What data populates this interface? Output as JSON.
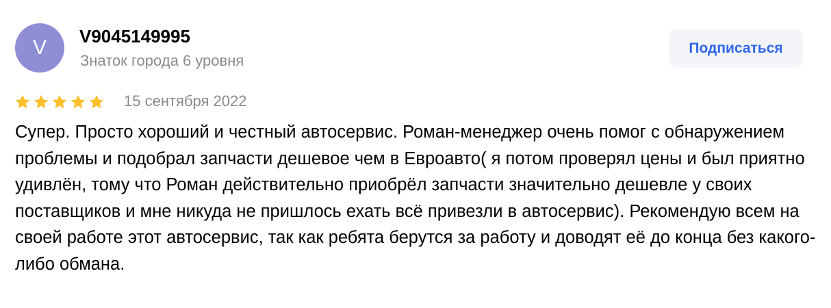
{
  "review": {
    "author": {
      "avatar_letter": "V",
      "avatar_color": "#8e8dd6",
      "name": "V9045149995",
      "level": "Знаток города 6 уровня"
    },
    "subscribe_label": "Подписаться",
    "rating": {
      "value": 5,
      "max": 5,
      "star_color": "#fdc02c",
      "icon": "star-icon"
    },
    "date": "15 сентября 2022",
    "text": "Супер. Просто хороший и честный автосервис. Роман-менеджер очень помог с обнаружением проблемы и подобрал запчасти дешевое чем в Евроавто( я потом проверял цены и был приятно удивлён, тому что Роман действительно приобрёл запчасти значительно дешевле у своих поставщиков и мне никуда не пришлось ехать всё привезли в автосервис). Рекомендую всем на своей работе этот автосервис, так как ребята берутся за работу и доводят её до конца без какого-либо обмана."
  },
  "colors": {
    "accent": "#2f65ee",
    "muted_text": "#8b8b8b",
    "button_bg": "#f3f5fb"
  }
}
